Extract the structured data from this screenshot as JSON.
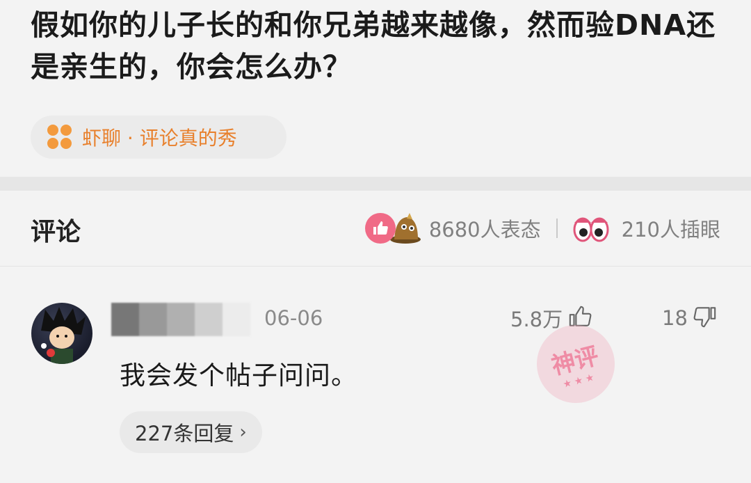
{
  "post": {
    "title": "假如你的儿子长的和你兄弟越来越像，然而验DNA还是亲生的，你会怎么办？"
  },
  "topic": {
    "label": "虾聊 · 评论真的秀",
    "icon": "flower-grid-icon",
    "color": "#e8802c"
  },
  "comments_header": {
    "title": "评论",
    "reactions_count_text": "8680人表态",
    "watchers_count_text": "210人插眼"
  },
  "comment": {
    "date": "06-06",
    "like_count": "5.8万",
    "dislike_count": "18",
    "text": "我会发个帖子问问。",
    "replies_label": "227条回复",
    "badge_text": "神评"
  },
  "colors": {
    "accent_orange": "#f39a3d",
    "like_pink": "#f06a86",
    "background": "#f3f3f3"
  }
}
